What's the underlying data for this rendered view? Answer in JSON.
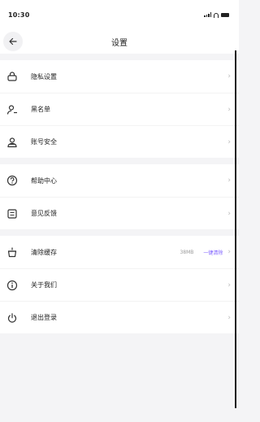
{
  "status_bar": {
    "time": "10:30"
  },
  "nav": {
    "title": "设置"
  },
  "groups": [
    [
      {
        "label": "隐私设置",
        "icon": "lock-icon"
      },
      {
        "label": "黑名单",
        "icon": "user-block-icon"
      },
      {
        "label": "账号安全",
        "icon": "shield-icon"
      }
    ],
    [
      {
        "label": "帮助中心",
        "icon": "help-icon"
      },
      {
        "label": "意见反馈",
        "icon": "feedback-icon"
      }
    ],
    [
      {
        "label": "清除缓存",
        "icon": "broom-icon",
        "value": "38MB",
        "action": "一键清除"
      },
      {
        "label": "关于我们",
        "icon": "info-icon"
      },
      {
        "label": "退出登录",
        "icon": "power-icon"
      }
    ]
  ],
  "colors": {
    "accent": "#7b5cff",
    "background": "#f4f4f6"
  }
}
